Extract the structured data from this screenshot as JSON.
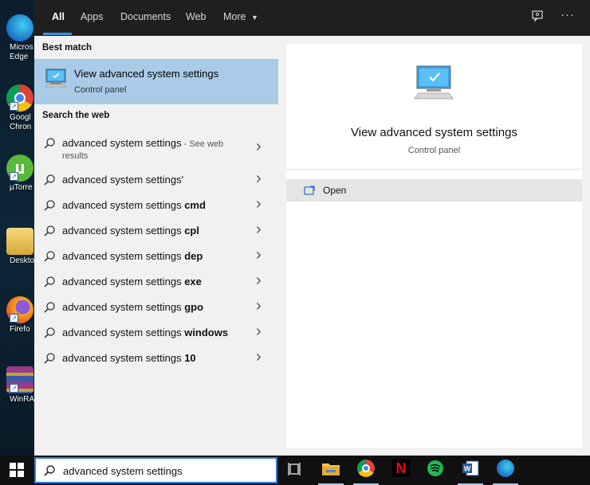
{
  "desktop": {
    "icons": [
      {
        "label": "Micros\nEdge",
        "icon": "edge-icon",
        "color": "#1f8fd8"
      },
      {
        "label": "Googl\nChron",
        "icon": "chrome-icon",
        "color": "#e04a3a"
      },
      {
        "label": "µTorre",
        "icon": "utorrent-icon",
        "color": "#4aa83a"
      },
      {
        "label": "Deskto",
        "icon": "folder-icon",
        "color": "#e8c25a"
      },
      {
        "label": "Firefo",
        "icon": "firefox-icon",
        "color": "#e86a1a"
      },
      {
        "label": "WinRA",
        "icon": "winrar-icon",
        "color": "#8a4a9a"
      }
    ]
  },
  "topbar": {
    "tabs": [
      {
        "label": "All",
        "active": true
      },
      {
        "label": "Apps",
        "active": false
      },
      {
        "label": "Documents",
        "active": false
      },
      {
        "label": "Web",
        "active": false
      },
      {
        "label": "More",
        "active": false
      }
    ],
    "feedback_icon": "feedback-icon",
    "more_options_icon": "ellipsis-icon"
  },
  "results": {
    "best_match_heading": "Best match",
    "best_match": {
      "title": "View advanced system settings",
      "subtitle": "Control panel",
      "icon": "monitor-settings-icon"
    },
    "web_heading": "Search the web",
    "web_items": [
      {
        "prefix": "advanced system settings",
        "suffix": "",
        "extra": " - See web",
        "extra2": "results"
      },
      {
        "prefix": "advanced system settings'",
        "suffix": ""
      },
      {
        "prefix": "advanced system settings ",
        "suffix": "cmd"
      },
      {
        "prefix": "advanced system settings ",
        "suffix": "cpl"
      },
      {
        "prefix": "advanced system settings ",
        "suffix": "dep"
      },
      {
        "prefix": "advanced system settings ",
        "suffix": "exe"
      },
      {
        "prefix": "advanced system settings ",
        "suffix": "gpo"
      },
      {
        "prefix": "advanced system settings ",
        "suffix": "windows"
      },
      {
        "prefix": "advanced system settings ",
        "suffix": "10"
      }
    ]
  },
  "detail": {
    "title": "View advanced system settings",
    "subtitle": "Control panel",
    "open_label": "Open"
  },
  "taskbar": {
    "search_value": "advanced system settings",
    "apps": [
      "windows-start-icon",
      "task-view-icon",
      "file-explorer-icon",
      "chrome-icon",
      "netflix-icon",
      "spotify-icon",
      "word-icon",
      "edge-icon"
    ]
  },
  "colors": {
    "accent": "#3a8ee6",
    "best_match_bg": "#a9cbe8",
    "panel_bg": "#f1f1f1",
    "topbar_bg": "#1f1f1f"
  }
}
